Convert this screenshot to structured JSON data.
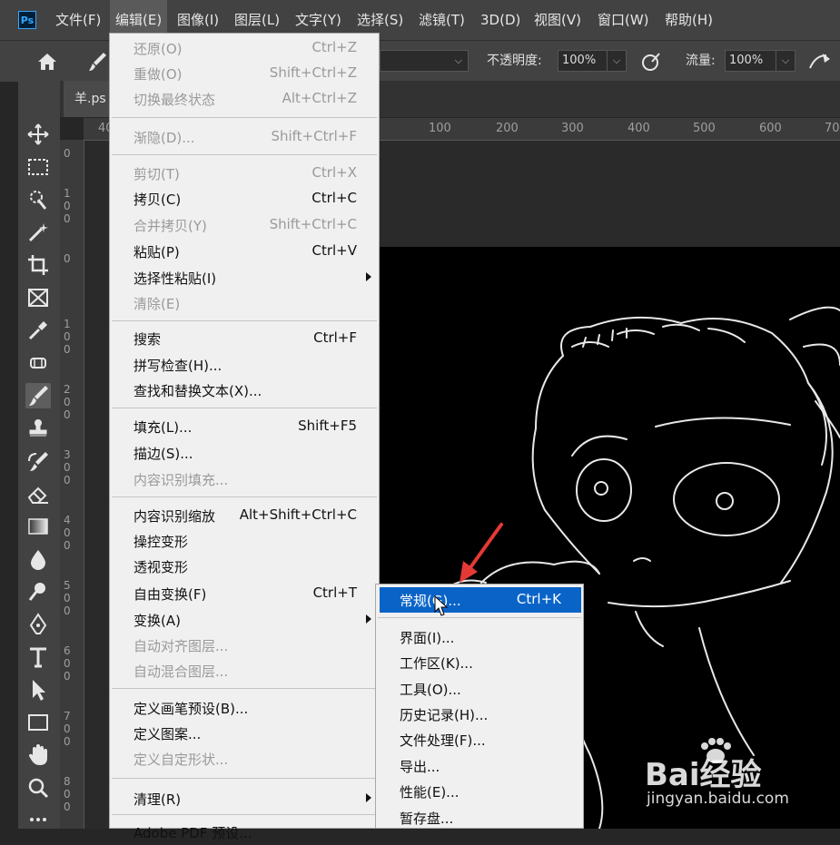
{
  "menubar": {
    "logo": "Ps",
    "items": [
      "文件(F)",
      "编辑(E)",
      "图像(I)",
      "图层(L)",
      "文字(Y)",
      "选择(S)",
      "滤镜(T)",
      "3D(D)",
      "视图(V)",
      "窗口(W)",
      "帮助(H)"
    ],
    "active": "编辑(E)"
  },
  "options": {
    "opacity_label": "不透明度:",
    "opacity_value": "100%",
    "flow_label": "流量:",
    "flow_value": "100%"
  },
  "document": {
    "tab_title": "羊.ps"
  },
  "ruler": {
    "h_ticks": [
      "40",
      "100",
      "200",
      "300",
      "400",
      "500",
      "600",
      "70"
    ],
    "v_ticks": [
      "0",
      "100",
      "0",
      "100",
      "200",
      "300",
      "400",
      "500",
      "600",
      "700",
      "800"
    ]
  },
  "edit_menu": {
    "items": [
      {
        "label": "还原(O)",
        "shortcut": "Ctrl+Z",
        "disabled": true
      },
      {
        "label": "重做(O)",
        "shortcut": "Shift+Ctrl+Z",
        "disabled": true
      },
      {
        "label": "切换最终状态",
        "shortcut": "Alt+Ctrl+Z",
        "disabled": true
      },
      {
        "label": "渐隐(D)...",
        "shortcut": "Shift+Ctrl+F",
        "disabled": true
      },
      {
        "label": "剪切(T)",
        "shortcut": "Ctrl+X",
        "disabled": true
      },
      {
        "label": "拷贝(C)",
        "shortcut": "Ctrl+C",
        "disabled": false
      },
      {
        "label": "合并拷贝(Y)",
        "shortcut": "Shift+Ctrl+C",
        "disabled": true
      },
      {
        "label": "粘贴(P)",
        "shortcut": "Ctrl+V",
        "disabled": false
      },
      {
        "label": "选择性粘贴(I)",
        "shortcut": "",
        "disabled": false,
        "submenu": true
      },
      {
        "label": "清除(E)",
        "shortcut": "",
        "disabled": true
      },
      {
        "label": "搜索",
        "shortcut": "Ctrl+F",
        "disabled": false
      },
      {
        "label": "拼写检查(H)...",
        "shortcut": "",
        "disabled": false
      },
      {
        "label": "查找和替换文本(X)...",
        "shortcut": "",
        "disabled": false
      },
      {
        "label": "填充(L)...",
        "shortcut": "Shift+F5",
        "disabled": false
      },
      {
        "label": "描边(S)...",
        "shortcut": "",
        "disabled": false
      },
      {
        "label": "内容识别填充...",
        "shortcut": "",
        "disabled": true
      },
      {
        "label": "内容识别缩放",
        "shortcut": "Alt+Shift+Ctrl+C",
        "disabled": false
      },
      {
        "label": "操控变形",
        "shortcut": "",
        "disabled": false
      },
      {
        "label": "透视变形",
        "shortcut": "",
        "disabled": false
      },
      {
        "label": "自由变换(F)",
        "shortcut": "Ctrl+T",
        "disabled": false
      },
      {
        "label": "变换(A)",
        "shortcut": "",
        "disabled": false,
        "submenu": true
      },
      {
        "label": "自动对齐图层...",
        "shortcut": "",
        "disabled": true
      },
      {
        "label": "自动混合图层...",
        "shortcut": "",
        "disabled": true
      },
      {
        "label": "定义画笔预设(B)...",
        "shortcut": "",
        "disabled": false
      },
      {
        "label": "定义图案...",
        "shortcut": "",
        "disabled": false
      },
      {
        "label": "定义自定形状...",
        "shortcut": "",
        "disabled": true
      },
      {
        "label": "清理(R)",
        "shortcut": "",
        "disabled": false,
        "submenu": true
      },
      {
        "label": "Adobe PDF 预设...",
        "shortcut": "",
        "disabled": false
      }
    ]
  },
  "preferences_submenu": {
    "items": [
      {
        "label": "常规(G)...",
        "shortcut": "Ctrl+K",
        "highlighted": true
      },
      {
        "label": "界面(I)...",
        "shortcut": ""
      },
      {
        "label": "工作区(K)...",
        "shortcut": ""
      },
      {
        "label": "工具(O)...",
        "shortcut": ""
      },
      {
        "label": "历史记录(H)...",
        "shortcut": ""
      },
      {
        "label": "文件处理(F)...",
        "shortcut": ""
      },
      {
        "label": "导出...",
        "shortcut": ""
      },
      {
        "label": "性能(E)...",
        "shortcut": ""
      },
      {
        "label": "暂存盘...",
        "shortcut": ""
      }
    ]
  },
  "watermark": {
    "brand": "Bai经验",
    "url": "jingyan.baidu.com"
  },
  "colors": {
    "menu_highlight": "#0a64c8",
    "annotation_arrow": "#e53935"
  },
  "tool_icons": [
    "move-icon",
    "marquee-icon",
    "quick-select-icon",
    "magic-wand-icon",
    "crop-icon",
    "frame-icon",
    "eyedropper-icon",
    "healing-brush-icon",
    "brush-icon",
    "clone-stamp-icon",
    "history-brush-icon",
    "eraser-icon",
    "gradient-icon",
    "blur-icon",
    "dodge-icon",
    "pen-icon",
    "type-icon",
    "path-select-icon",
    "rectangle-icon",
    "hand-icon",
    "zoom-icon",
    "more-tools-icon"
  ]
}
